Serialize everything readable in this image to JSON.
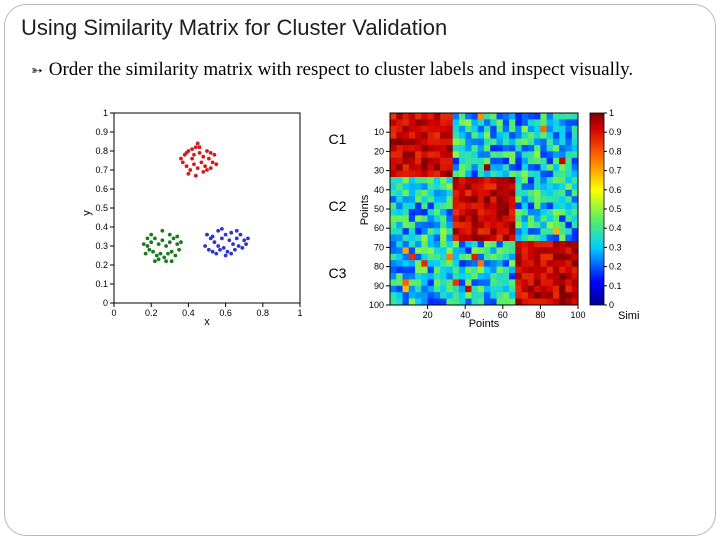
{
  "title": "Using Similarity Matrix for Cluster Validation",
  "bullet": "Order the similarity matrix with respect to cluster labels and inspect visually.",
  "cluster_labels": [
    "C1",
    "C2",
    "C3"
  ],
  "scatter": {
    "xlabel": "x",
    "ylabel": "y",
    "xticks": [
      "0",
      "0.2",
      "0.4",
      "0.6",
      "0.8",
      "1"
    ],
    "yticks": [
      "0",
      "0.1",
      "0.2",
      "0.3",
      "0.4",
      "0.5",
      "0.6",
      "0.7",
      "0.8",
      "0.9",
      "1"
    ]
  },
  "heatmap": {
    "xlabel": "Points",
    "ylabel": "Points",
    "cbar_label": "Similarity",
    "xticks": [
      "20",
      "40",
      "60",
      "80",
      "100"
    ],
    "yticks": [
      "10",
      "20",
      "30",
      "40",
      "50",
      "60",
      "70",
      "80",
      "90",
      "100"
    ],
    "cbar_ticks": [
      "0",
      "0.1",
      "0.2",
      "0.3",
      "0.4",
      "0.5",
      "0.6",
      "0.7",
      "0.8",
      "0.9",
      "1"
    ]
  },
  "chart_data": [
    {
      "type": "scatter",
      "title": "",
      "xlabel": "x",
      "ylabel": "y",
      "xlim": [
        0,
        1
      ],
      "ylim": [
        0,
        1
      ],
      "series": [
        {
          "name": "C1",
          "color": "#d11c1c",
          "points": [
            [
              0.38,
              0.78
            ],
            [
              0.4,
              0.8
            ],
            [
              0.42,
              0.76
            ],
            [
              0.44,
              0.82
            ],
            [
              0.46,
              0.79
            ],
            [
              0.48,
              0.77
            ],
            [
              0.5,
              0.8
            ],
            [
              0.37,
              0.74
            ],
            [
              0.39,
              0.72
            ],
            [
              0.41,
              0.7
            ],
            [
              0.43,
              0.73
            ],
            [
              0.45,
              0.71
            ],
            [
              0.47,
              0.74
            ],
            [
              0.49,
              0.72
            ],
            [
              0.51,
              0.76
            ],
            [
              0.53,
              0.74
            ],
            [
              0.36,
              0.76
            ],
            [
              0.4,
              0.68
            ],
            [
              0.44,
              0.67
            ],
            [
              0.48,
              0.69
            ],
            [
              0.52,
              0.71
            ],
            [
              0.54,
              0.78
            ],
            [
              0.55,
              0.73
            ],
            [
              0.46,
              0.82
            ],
            [
              0.42,
              0.81
            ],
            [
              0.39,
              0.79
            ],
            [
              0.5,
              0.7
            ],
            [
              0.52,
              0.79
            ],
            [
              0.45,
              0.84
            ],
            [
              0.43,
              0.78
            ]
          ]
        },
        {
          "name": "C2",
          "color": "#2e37c9",
          "points": [
            [
              0.5,
              0.36
            ],
            [
              0.52,
              0.34
            ],
            [
              0.54,
              0.32
            ],
            [
              0.56,
              0.3
            ],
            [
              0.58,
              0.34
            ],
            [
              0.6,
              0.36
            ],
            [
              0.62,
              0.33
            ],
            [
              0.64,
              0.31
            ],
            [
              0.66,
              0.34
            ],
            [
              0.68,
              0.36
            ],
            [
              0.7,
              0.33
            ],
            [
              0.49,
              0.3
            ],
            [
              0.51,
              0.28
            ],
            [
              0.53,
              0.27
            ],
            [
              0.55,
              0.26
            ],
            [
              0.57,
              0.28
            ],
            [
              0.59,
              0.29
            ],
            [
              0.61,
              0.27
            ],
            [
              0.63,
              0.26
            ],
            [
              0.65,
              0.28
            ],
            [
              0.67,
              0.3
            ],
            [
              0.69,
              0.29
            ],
            [
              0.71,
              0.31
            ],
            [
              0.56,
              0.38
            ],
            [
              0.58,
              0.39
            ],
            [
              0.53,
              0.35
            ],
            [
              0.66,
              0.38
            ],
            [
              0.6,
              0.25
            ],
            [
              0.63,
              0.37
            ],
            [
              0.72,
              0.34
            ]
          ]
        },
        {
          "name": "C3",
          "color": "#1d7a1d",
          "points": [
            [
              0.18,
              0.3
            ],
            [
              0.2,
              0.32
            ],
            [
              0.22,
              0.34
            ],
            [
              0.24,
              0.31
            ],
            [
              0.26,
              0.33
            ],
            [
              0.28,
              0.3
            ],
            [
              0.3,
              0.32
            ],
            [
              0.32,
              0.34
            ],
            [
              0.34,
              0.31
            ],
            [
              0.17,
              0.26
            ],
            [
              0.19,
              0.28
            ],
            [
              0.21,
              0.27
            ],
            [
              0.23,
              0.25
            ],
            [
              0.25,
              0.26
            ],
            [
              0.27,
              0.24
            ],
            [
              0.29,
              0.26
            ],
            [
              0.31,
              0.27
            ],
            [
              0.33,
              0.25
            ],
            [
              0.35,
              0.28
            ],
            [
              0.2,
              0.36
            ],
            [
              0.26,
              0.38
            ],
            [
              0.3,
              0.36
            ],
            [
              0.18,
              0.34
            ],
            [
              0.24,
              0.23
            ],
            [
              0.28,
              0.22
            ],
            [
              0.22,
              0.22
            ],
            [
              0.34,
              0.35
            ],
            [
              0.36,
              0.32
            ],
            [
              0.16,
              0.31
            ],
            [
              0.31,
              0.22
            ]
          ]
        }
      ]
    },
    {
      "type": "heatmap",
      "title": "",
      "xlabel": "Points",
      "ylabel": "Points",
      "xlim": [
        0,
        100
      ],
      "ylim": [
        0,
        100
      ],
      "colorbar": {
        "label": "Similarity",
        "range": [
          0,
          1
        ]
      },
      "description": "100x100 similarity matrix ordered by cluster; three diagonal blocks (~33x33 each) with high similarity (~0.9-1.0, red/orange); off-diagonal blocks low similarity (~0.2-0.5, cyan/blue) with scattered noise."
    }
  ]
}
